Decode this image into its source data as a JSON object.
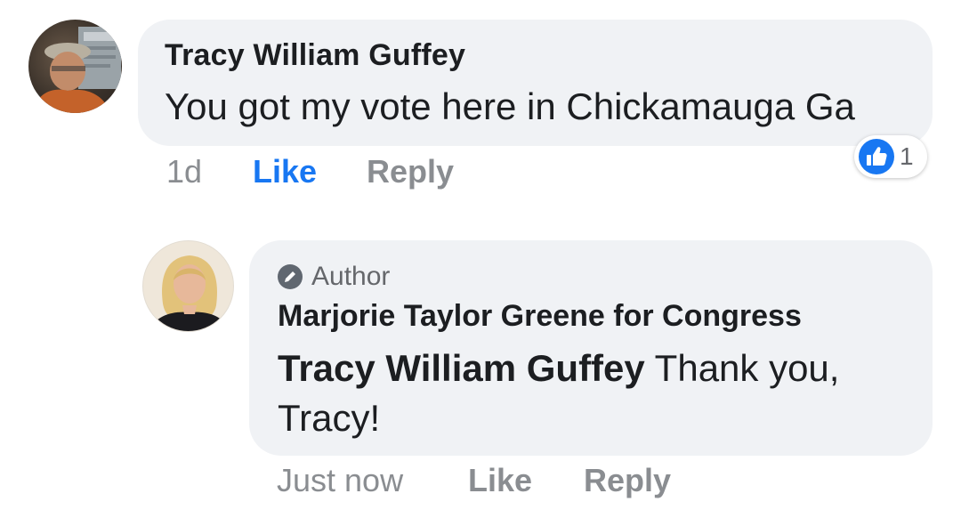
{
  "colors": {
    "bubble_background": "#f0f2f5",
    "like_active": "#1877f2",
    "muted_text": "#8a8d91",
    "primary_text": "#1c1e21"
  },
  "comments": [
    {
      "avatar_icon": "user-avatar-photo",
      "author": "Tracy William Guffey",
      "text": "You got my vote here in Chickamauga Ga",
      "timestamp": "1d",
      "like_label": "Like",
      "reply_label": "Reply",
      "liked": true,
      "reaction": {
        "icon": "thumbs-up-icon",
        "count": "1"
      }
    },
    {
      "avatar_icon": "user-avatar-photo",
      "badge": {
        "icon": "pencil-icon",
        "label": "Author"
      },
      "author": "Marjorie Taylor Greene for Congress",
      "mention": "Tracy William Guffey",
      "text": " Thank you, Tracy!",
      "timestamp": "Just now",
      "like_label": "Like",
      "reply_label": "Reply",
      "liked": false
    }
  ]
}
